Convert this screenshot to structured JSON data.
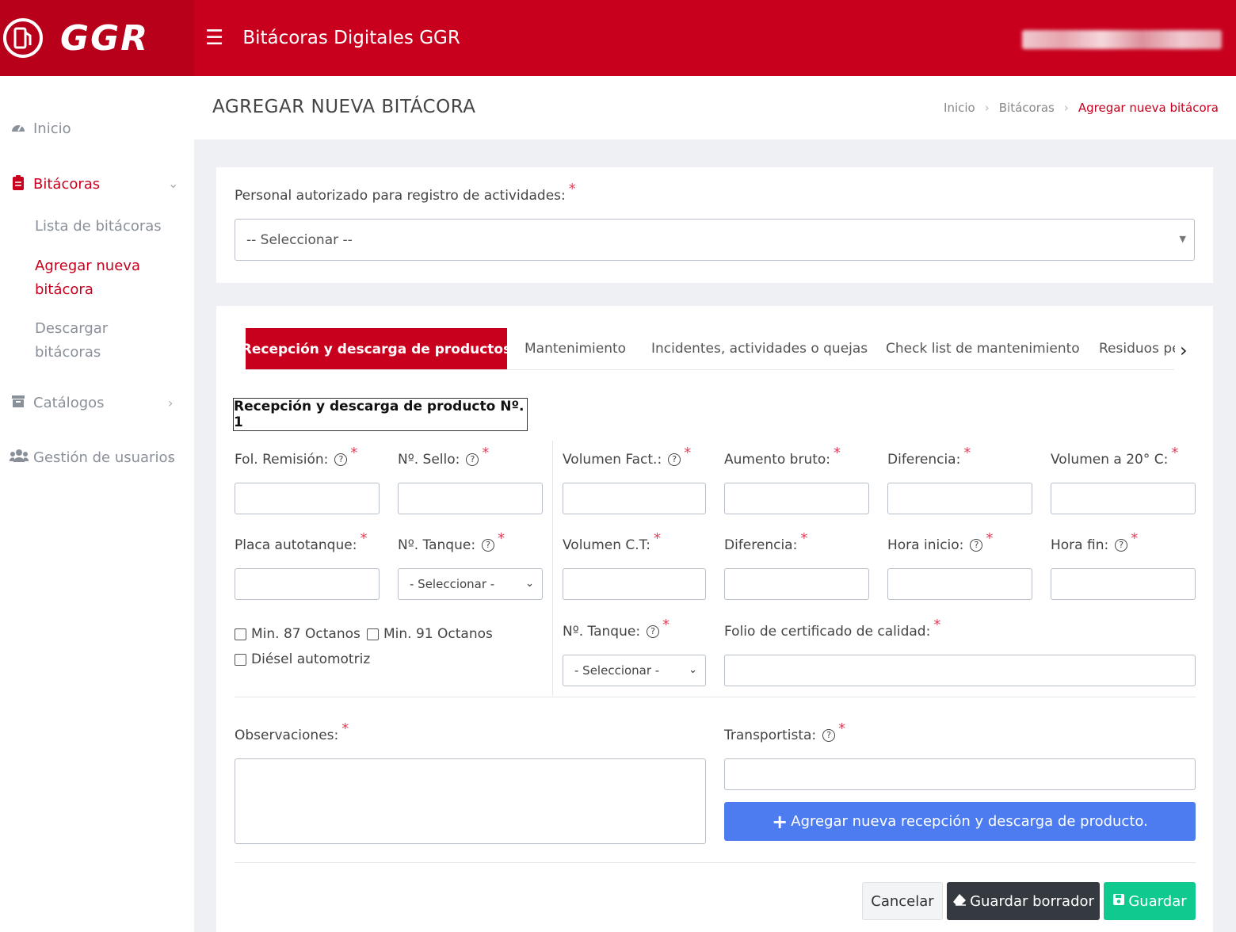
{
  "topbar": {
    "brand_name": "GGR",
    "menu_icon": "hamburger-icon",
    "title": "Bitácoras Digitales GGR"
  },
  "sidebar": {
    "inicio": "Inicio",
    "bitacoras": "Bitácoras",
    "lista": "Lista de bitácoras",
    "agregar": "Agregar nueva bitácora",
    "descargar": "Descargar bitácoras",
    "catalogos": "Catálogos",
    "gestion": "Gestión de usuarios"
  },
  "page": {
    "title": "AGREGAR NUEVA BITÁCORA",
    "breadcrumb": [
      "Inicio",
      "Bitácoras",
      "Agregar nueva bitácora"
    ]
  },
  "personal": {
    "label": "Personal autorizado para registro de actividades:",
    "select_value": "-- Seleccionar --"
  },
  "tabs": [
    "Recepción y descarga de productos",
    "Mantenimiento",
    "Incidentes, actividades o quejas",
    "Check list de mantenimiento",
    "Residuos pe"
  ],
  "form": {
    "section_title": "Recepción y descarga de producto Nº. 1",
    "fol_remision": "Fol. Remisión:",
    "no_sello": "Nº. Sello:",
    "volumen_fact": "Volumen Fact.:",
    "aumento_bruto": "Aumento bruto:",
    "diferencia1": "Diferencia:",
    "volumen_20": "Volumen a 20° C:",
    "placa": "Placa autotanque:",
    "no_tanque1": "Nº. Tanque:",
    "tanque1_value": "- Seleccionar -",
    "volumen_ct": "Volumen C.T:",
    "diferencia2": "Diferencia:",
    "hora_inicio": "Hora inicio:",
    "hora_fin": "Hora fin:",
    "chk_87": "Min. 87 Octanos",
    "chk_91": "Min. 91 Octanos",
    "chk_diesel": "Diésel automotriz",
    "no_tanque2": "Nº. Tanque:",
    "tanque2_value": "- Seleccionar -",
    "folio_cert": "Folio de certificado de calidad:",
    "observaciones": "Observaciones:",
    "transportista": "Transportista:",
    "add_button": "Agregar nueva recepción y descarga de producto.",
    "required_mark": "*",
    "help_mark": "?"
  },
  "actions": {
    "cancel": "Cancelar",
    "draft": "Guardar borrador",
    "save": "Guardar"
  },
  "colors": {
    "brand_red": "#c8001e",
    "primary_blue": "#4c7cf0",
    "success_green": "#10c98f",
    "dark_button": "#343a40"
  }
}
